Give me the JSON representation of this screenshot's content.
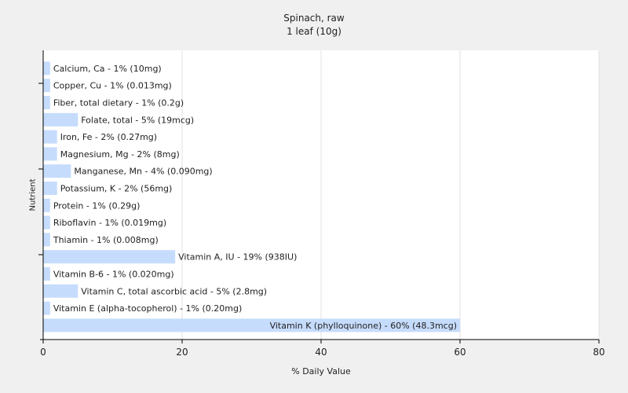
{
  "chart_data": {
    "type": "bar",
    "orientation": "horizontal",
    "title": "Spinach, raw",
    "subtitle": "1 leaf (10g)",
    "xlabel": "% Daily Value",
    "ylabel": "Nutrient",
    "xlim": [
      0,
      80
    ],
    "xticks": [
      0,
      20,
      40,
      60,
      80
    ],
    "grid": "vertical",
    "bar_color": "#c6dcfc",
    "bars": [
      {
        "category": "Calcium, Ca",
        "value": 1,
        "label": "Calcium, Ca - 1% (10mg)"
      },
      {
        "category": "Copper, Cu",
        "value": 1,
        "label": "Copper, Cu - 1% (0.013mg)"
      },
      {
        "category": "Fiber, total dietary",
        "value": 1,
        "label": "Fiber, total dietary - 1% (0.2g)"
      },
      {
        "category": "Folate, total",
        "value": 5,
        "label": "Folate, total - 5% (19mcg)"
      },
      {
        "category": "Iron, Fe",
        "value": 2,
        "label": "Iron, Fe - 2% (0.27mg)"
      },
      {
        "category": "Magnesium, Mg",
        "value": 2,
        "label": "Magnesium, Mg - 2% (8mg)"
      },
      {
        "category": "Manganese, Mn",
        "value": 4,
        "label": "Manganese, Mn - 4% (0.090mg)"
      },
      {
        "category": "Potassium, K",
        "value": 2,
        "label": "Potassium, K - 2% (56mg)"
      },
      {
        "category": "Protein",
        "value": 1,
        "label": "Protein - 1% (0.29g)"
      },
      {
        "category": "Riboflavin",
        "value": 1,
        "label": "Riboflavin - 1% (0.019mg)"
      },
      {
        "category": "Thiamin",
        "value": 1,
        "label": "Thiamin - 1% (0.008mg)"
      },
      {
        "category": "Vitamin A, IU",
        "value": 19,
        "label": "Vitamin A, IU - 19% (938IU)"
      },
      {
        "category": "Vitamin B-6",
        "value": 1,
        "label": "Vitamin B-6 - 1% (0.020mg)"
      },
      {
        "category": "Vitamin C, total ascorbic acid",
        "value": 5,
        "label": "Vitamin C, total ascorbic acid - 5% (2.8mg)"
      },
      {
        "category": "Vitamin E (alpha-tocopherol)",
        "value": 1,
        "label": "Vitamin E (alpha-tocopherol) - 1% (0.20mg)"
      },
      {
        "category": "Vitamin K (phylloquinone)",
        "value": 60,
        "label": "Vitamin K (phylloquinone) - 60% (48.3mcg)"
      }
    ]
  }
}
